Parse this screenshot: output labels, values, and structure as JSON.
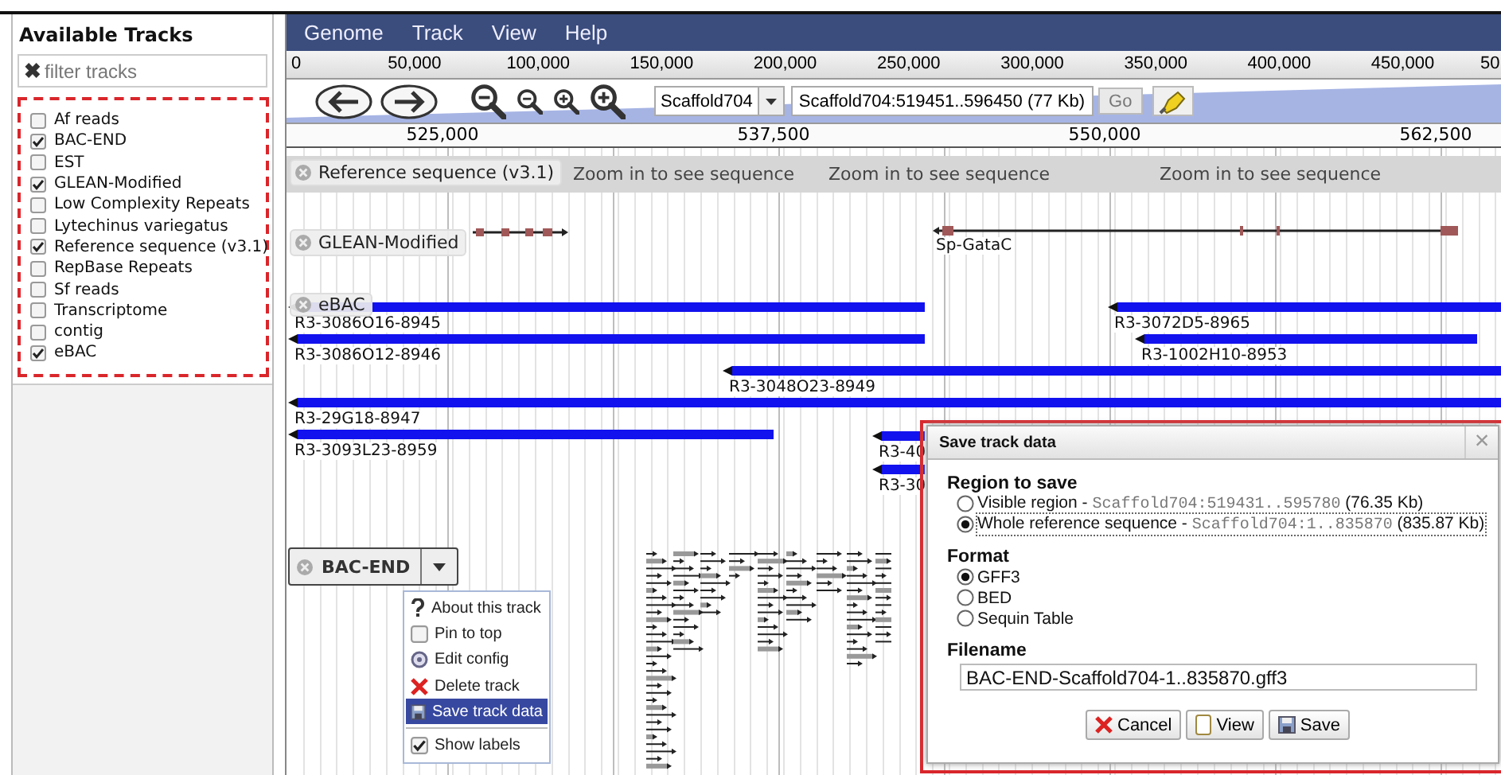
{
  "sidebar": {
    "title": "Available Tracks",
    "filter": {
      "icon": "✖",
      "placeholder": "filter tracks"
    },
    "tracks": [
      {
        "label": "Af reads",
        "checked": false
      },
      {
        "label": "BAC-END",
        "checked": true
      },
      {
        "label": "EST",
        "checked": false
      },
      {
        "label": "GLEAN-Modified",
        "checked": true
      },
      {
        "label": "Low Complexity Repeats",
        "checked": false
      },
      {
        "label": "Lytechinus variegatus",
        "checked": false
      },
      {
        "label": "Reference sequence (v3.1)",
        "checked": true
      },
      {
        "label": "RepBase Repeats",
        "checked": false
      },
      {
        "label": "Sf reads",
        "checked": false
      },
      {
        "label": "Transcriptome",
        "checked": false
      },
      {
        "label": "contig",
        "checked": false
      },
      {
        "label": "eBAC",
        "checked": true
      }
    ]
  },
  "menu": [
    "Genome",
    "Track",
    "View",
    "Help"
  ],
  "overview_ruler": [
    "0",
    "50,000",
    "100,000",
    "150,000",
    "200,000",
    "250,000",
    "300,000",
    "350,000",
    "400,000",
    "450,000",
    "50"
  ],
  "navigation": {
    "reference": "Scaffold704",
    "location": "Scaffold704:519451..596450 (77 Kb)",
    "go": "Go"
  },
  "detail_ruler": [
    "525,000",
    "537,500",
    "550,000",
    "562,500"
  ],
  "tracks": [
    {
      "kind": "sequence",
      "label": "Reference sequence (v3.1)",
      "messages": [
        "Zoom in to see sequence",
        "Zoom in to see sequence",
        "Zoom in to see sequence"
      ]
    },
    {
      "kind": "genes",
      "label": "GLEAN-Modified",
      "features": [
        "Sp-GataC"
      ]
    },
    {
      "kind": "features",
      "label": "eBAC",
      "features": [
        "R3-3086O16-8945",
        "R3-3072D5-8965",
        "R3-3086O12-8946",
        "R3-1002H10-8953",
        "R3-3048O23-8949",
        "R3-29G18-8947",
        "R3-3093L23-8959",
        "R3-40",
        "R3-30"
      ]
    },
    {
      "kind": "alignments",
      "label": "BAC-END"
    }
  ],
  "track_menu": [
    {
      "kind": "action",
      "label": "About this track",
      "selected": false
    },
    {
      "kind": "toggle",
      "label": "Pin to top",
      "checked": false,
      "selected": false
    },
    {
      "kind": "action",
      "label": "Edit config",
      "selected": false
    },
    {
      "kind": "action",
      "label": "Delete track",
      "selected": false
    },
    {
      "kind": "action",
      "label": "Save track data",
      "selected": true
    },
    {
      "kind": "toggle",
      "label": "Show labels",
      "checked": true,
      "selected": false
    }
  ],
  "dialog": {
    "title": "Save track data",
    "close": "×",
    "region": {
      "heading": "Region to save",
      "options": [
        {
          "label": "Visible region - ",
          "range": "Scaffold704:519431..595780",
          "size": "(76.35 Kb)",
          "selected": false
        },
        {
          "label": "Whole reference sequence - ",
          "range": "Scaffold704:1..835870",
          "size": "(835.87 Kb)",
          "selected": true
        }
      ]
    },
    "format": {
      "heading": "Format",
      "options": [
        {
          "label": "GFF3",
          "selected": true
        },
        {
          "label": "BED",
          "selected": false
        },
        {
          "label": "Sequin Table",
          "selected": false
        }
      ]
    },
    "filename": {
      "heading": "Filename",
      "value": "BAC-END-Scaffold704-1..835870.gff3"
    },
    "buttons": [
      "Cancel",
      "View",
      "Save"
    ]
  }
}
